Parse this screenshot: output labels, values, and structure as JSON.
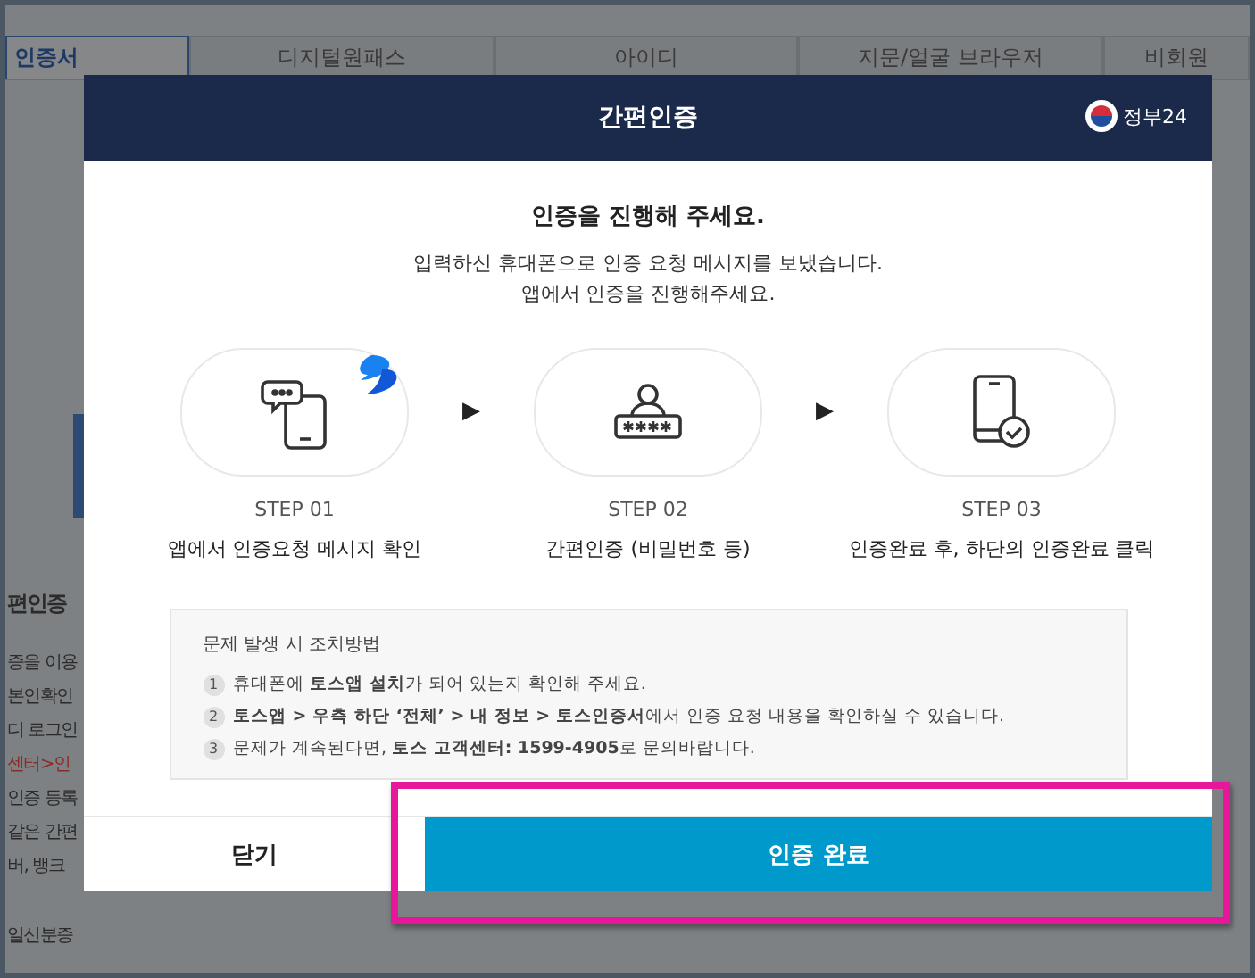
{
  "background_page": {
    "tabs": [
      {
        "label": "인증서",
        "selected": true
      },
      {
        "label": "디지털원패스",
        "selected": false
      },
      {
        "label": "아이디",
        "selected": false
      },
      {
        "label": "지문/얼굴 브라우저",
        "selected": false
      },
      {
        "label": "비회원",
        "selected": false
      }
    ],
    "heading": "편인증",
    "lines": [
      {
        "text": "증을 이용",
        "kind": "plain"
      },
      {
        "text": "본인확인",
        "kind": "plain"
      },
      {
        "text": "디 로그인",
        "kind": "plain"
      },
      {
        "text": "센터>인",
        "kind": "link"
      },
      {
        "text": "인증 등록",
        "kind": "plain"
      },
      {
        "text": "같은 간편",
        "kind": "plain"
      },
      {
        "text": "버, 뱅크",
        "kind": "plain"
      },
      {
        "text": "일신분증",
        "kind": "plain"
      }
    ]
  },
  "modal": {
    "title": "간편인증",
    "logo_text": "정부24",
    "heading": "인증을 진행해 주세요.",
    "description": [
      "입력하신 휴대폰으로 인증 요청 메시지를 보냈습니다.",
      "앱에서 인증을 진행해주세요."
    ],
    "steps": [
      {
        "kind": "message",
        "label": "STEP 01",
        "caption": "앱에서 인증요청 메시지 확인"
      },
      {
        "kind": "password",
        "label": "STEP 02",
        "caption": "간편인증 (비밀번호 등)"
      },
      {
        "kind": "check",
        "label": "STEP 03",
        "caption": "인증완료 후, 하단의 인증완료 클릭"
      }
    ],
    "arrow": "▶",
    "help": {
      "title": "문제 발생 시 조치방법",
      "items": [
        {
          "number": "1",
          "text": "휴대폰에 **토스앱 설치**가 되어 있는지 확인해 주세요."
        },
        {
          "number": "2",
          "text": "**토스앱 > 우측 하단 ‘전체’ > 내 정보 > 토스인증서**에서 인증 요청 내용을 확인하실 수 있습니다."
        },
        {
          "number": "3",
          "text": "문제가 계속된다면, **토스 고객센터: 1599-4905**로 문의바랍니다."
        }
      ]
    },
    "buttons": [
      {
        "label": "닫기",
        "kind": "secondary"
      },
      {
        "label": "인증 완료",
        "kind": "primary",
        "highlighted": true
      }
    ]
  }
}
